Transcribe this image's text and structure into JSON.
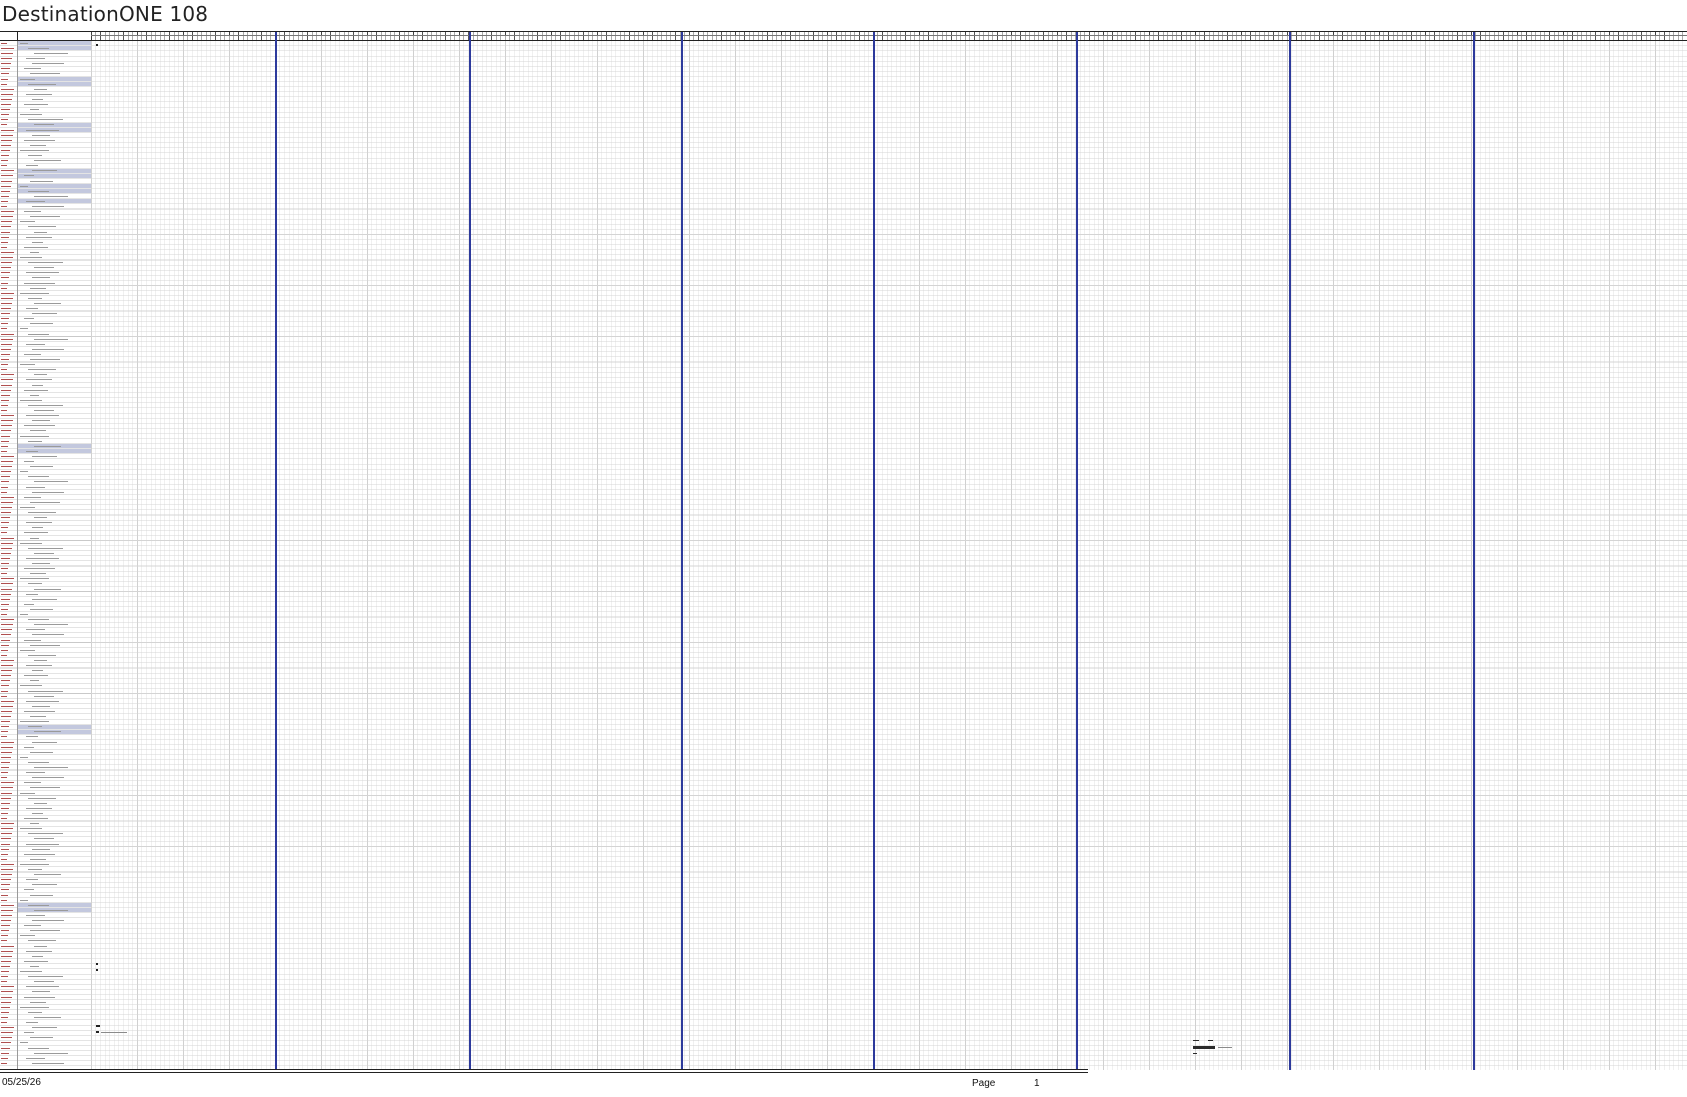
{
  "document": {
    "title": "DestinationONE 108"
  },
  "footer": {
    "date": "05/25/26",
    "page_label": "Page",
    "page_number": "1"
  },
  "colors": {
    "blue_marker_lines": "#2d3a9c",
    "summary_band": "#c3c8de",
    "grid_line": "#d4d4d4"
  }
}
